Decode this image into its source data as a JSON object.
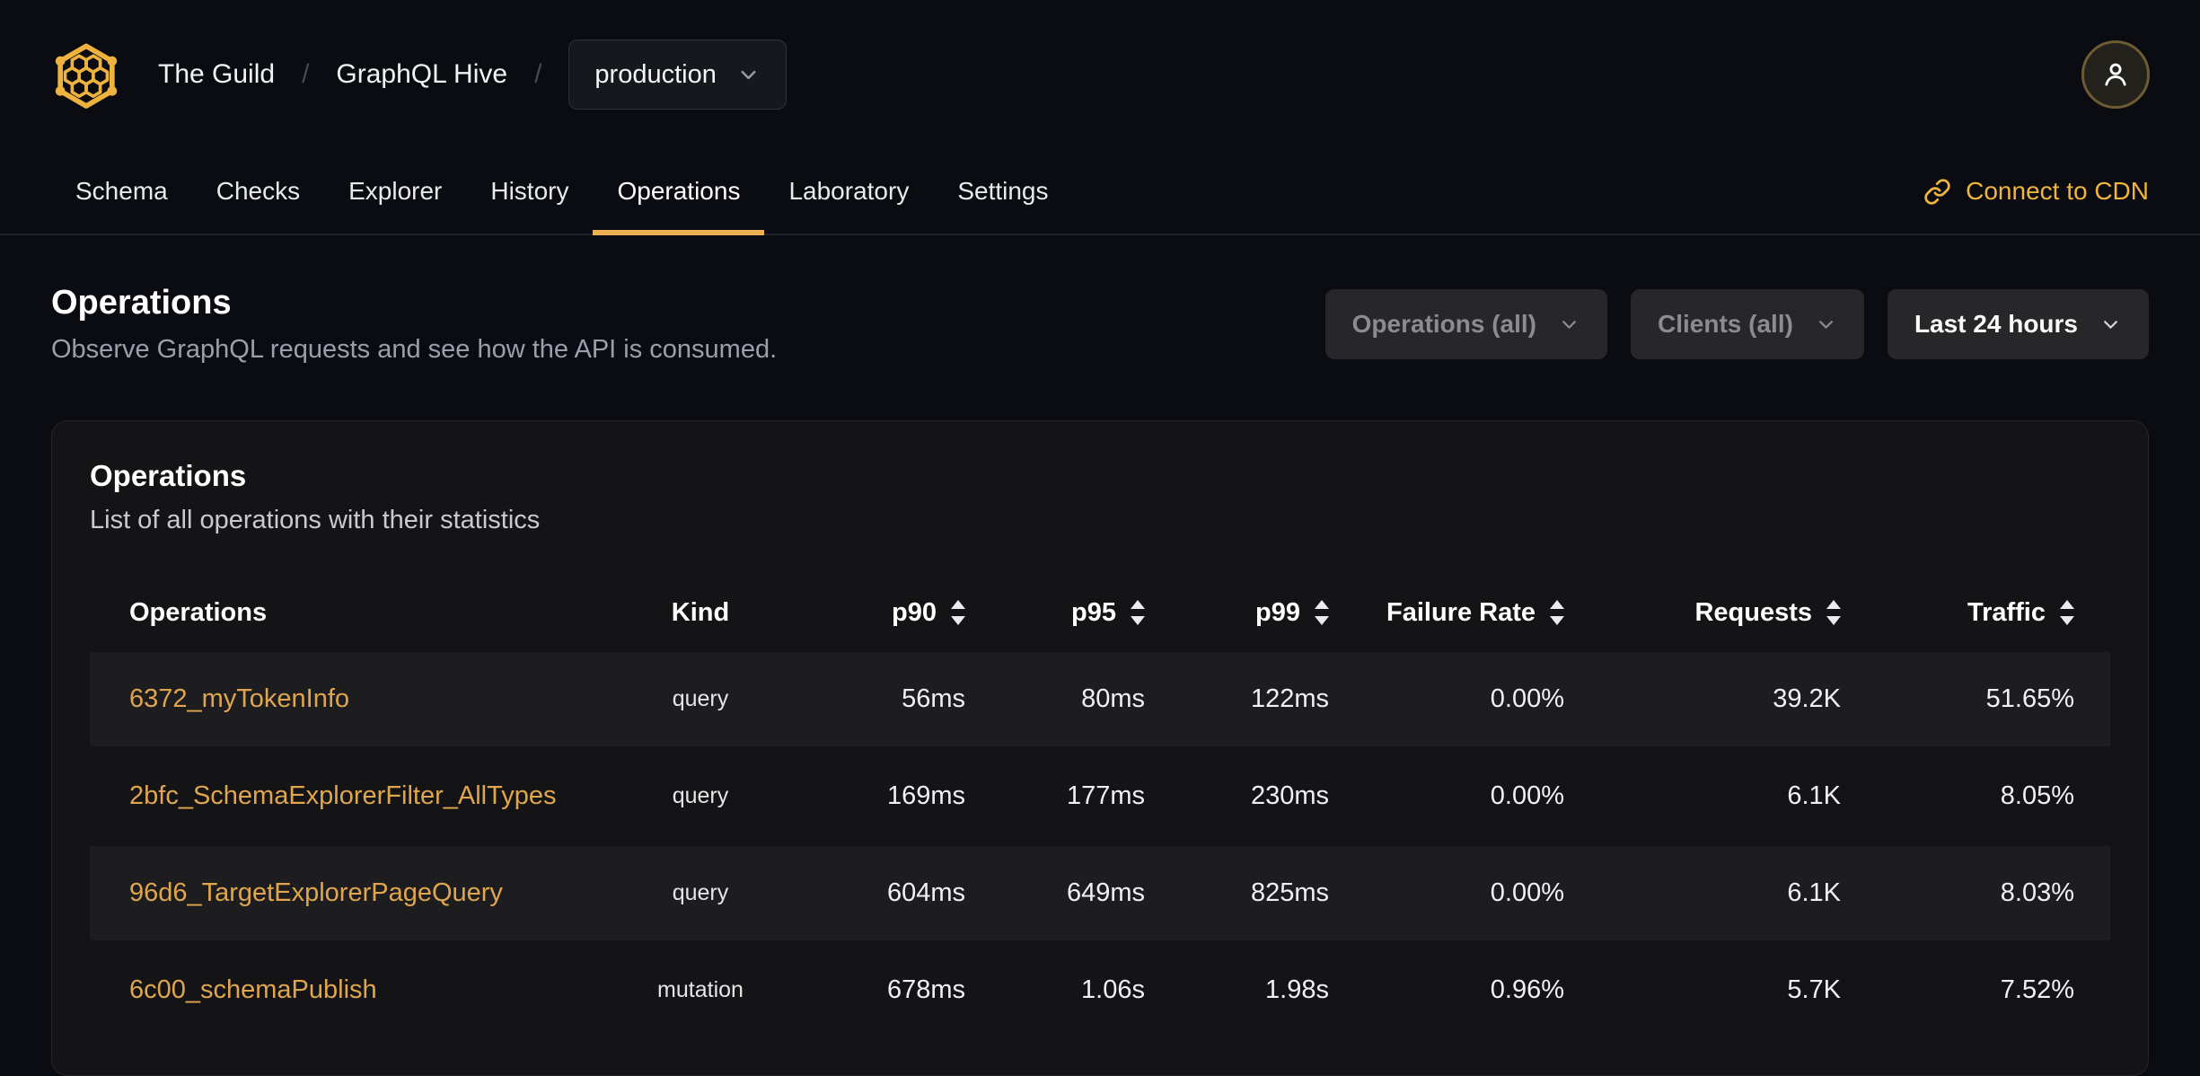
{
  "topbar": {
    "org": "The Guild",
    "separator": "/",
    "project": "GraphQL Hive",
    "target": "production"
  },
  "tabs": [
    {
      "label": "Schema",
      "active": false
    },
    {
      "label": "Checks",
      "active": false
    },
    {
      "label": "Explorer",
      "active": false
    },
    {
      "label": "History",
      "active": false
    },
    {
      "label": "Operations",
      "active": true
    },
    {
      "label": "Laboratory",
      "active": false
    },
    {
      "label": "Settings",
      "active": false
    }
  ],
  "cdn": {
    "label": "Connect to CDN"
  },
  "page_header": {
    "title": "Operations",
    "subtitle": "Observe GraphQL requests and see how the API is consumed."
  },
  "filters": [
    {
      "label": "Operations (all)",
      "enabled": false
    },
    {
      "label": "Clients (all)",
      "enabled": false
    },
    {
      "label": "Last 24 hours",
      "enabled": true
    }
  ],
  "card": {
    "title": "Operations",
    "subtitle": "List of all operations with their statistics"
  },
  "table": {
    "columns": [
      {
        "key": "name",
        "label": "Operations",
        "sortable": false,
        "align": "left"
      },
      {
        "key": "kind",
        "label": "Kind",
        "sortable": false,
        "align": "center"
      },
      {
        "key": "p90",
        "label": "p90",
        "sortable": true,
        "align": "right"
      },
      {
        "key": "p95",
        "label": "p95",
        "sortable": true,
        "align": "right"
      },
      {
        "key": "p99",
        "label": "p99",
        "sortable": true,
        "align": "right"
      },
      {
        "key": "failure_rate",
        "label": "Failure Rate",
        "sortable": true,
        "align": "right"
      },
      {
        "key": "requests",
        "label": "Requests",
        "sortable": true,
        "align": "right"
      },
      {
        "key": "traffic",
        "label": "Traffic",
        "sortable": true,
        "align": "right"
      }
    ],
    "rows": [
      {
        "name": "6372_myTokenInfo",
        "kind": "query",
        "p90": "56ms",
        "p95": "80ms",
        "p99": "122ms",
        "failure_rate": "0.00%",
        "requests": "39.2K",
        "traffic": "51.65%"
      },
      {
        "name": "2bfc_SchemaExplorerFilter_AllTypes",
        "kind": "query",
        "p90": "169ms",
        "p95": "177ms",
        "p99": "230ms",
        "failure_rate": "0.00%",
        "requests": "6.1K",
        "traffic": "8.05%"
      },
      {
        "name": "96d6_TargetExplorerPageQuery",
        "kind": "query",
        "p90": "604ms",
        "p95": "649ms",
        "p99": "825ms",
        "failure_rate": "0.00%",
        "requests": "6.1K",
        "traffic": "8.03%"
      },
      {
        "name": "6c00_schemaPublish",
        "kind": "mutation",
        "p90": "678ms",
        "p95": "1.06s",
        "p99": "1.98s",
        "failure_rate": "0.96%",
        "requests": "5.7K",
        "traffic": "7.52%"
      }
    ]
  },
  "colors": {
    "page_bg": "#0a0c11",
    "card_bg": "#141416",
    "row_stripe": "#1d1d20",
    "accent": "#ecb152",
    "cdn_link": "#f0b53e",
    "link": "#dfa64d",
    "logo_gold": "#eeb33f"
  }
}
